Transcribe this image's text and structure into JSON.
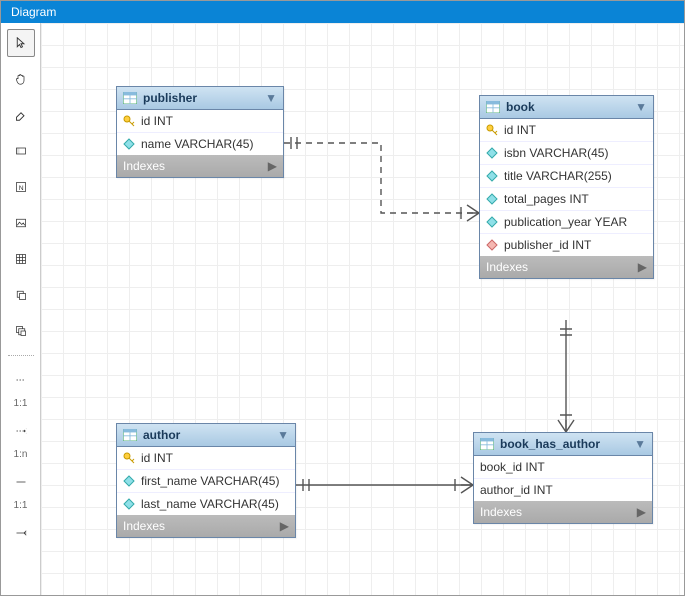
{
  "title": "Diagram",
  "toolbar": {
    "items": [
      {
        "name": "pointer-tool",
        "label": "Pointer"
      },
      {
        "name": "hand-tool",
        "label": "Hand"
      },
      {
        "name": "eraser-tool",
        "label": "Eraser"
      },
      {
        "name": "layer-tool",
        "label": "Layer"
      },
      {
        "name": "note-tool",
        "label": "Note"
      },
      {
        "name": "image-tool",
        "label": "Image"
      },
      {
        "name": "table-tool",
        "label": "Table"
      },
      {
        "name": "view-tool-1",
        "label": "View"
      },
      {
        "name": "view-tool-2",
        "label": "View2"
      }
    ],
    "rel_labels": [
      "1:1",
      "1:n",
      "1:1"
    ]
  },
  "entities": {
    "publisher": {
      "title": "publisher",
      "indexes": "Indexes",
      "rows": [
        {
          "icon": "key",
          "text": "id INT"
        },
        {
          "icon": "col",
          "text": "name VARCHAR(45)"
        }
      ]
    },
    "book": {
      "title": "book",
      "indexes": "Indexes",
      "rows": [
        {
          "icon": "key",
          "text": "id INT"
        },
        {
          "icon": "col",
          "text": "isbn VARCHAR(45)"
        },
        {
          "icon": "col",
          "text": "title VARCHAR(255)"
        },
        {
          "icon": "col",
          "text": "total_pages INT"
        },
        {
          "icon": "col",
          "text": "publication_year YEAR"
        },
        {
          "icon": "fk",
          "text": "publisher_id INT"
        }
      ]
    },
    "author": {
      "title": "author",
      "indexes": "Indexes",
      "rows": [
        {
          "icon": "key",
          "text": "id INT"
        },
        {
          "icon": "col",
          "text": "first_name VARCHAR(45)"
        },
        {
          "icon": "col",
          "text": "last_name VARCHAR(45)"
        }
      ]
    },
    "book_has_author": {
      "title": "book_has_author",
      "indexes": "Indexes",
      "rows": [
        {
          "icon": "none",
          "text": "book_id INT"
        },
        {
          "icon": "none",
          "text": "author_id INT"
        }
      ]
    }
  }
}
